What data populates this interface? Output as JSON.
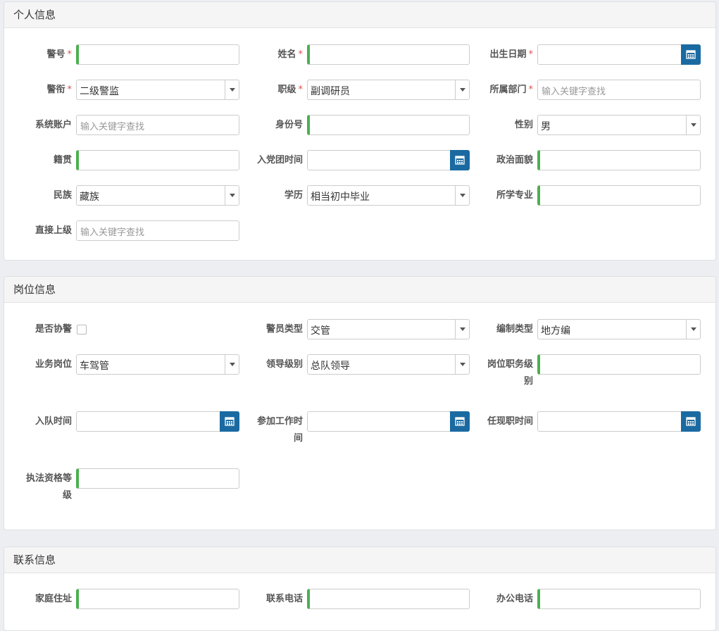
{
  "sections": {
    "personal": {
      "title": "个人信息"
    },
    "position": {
      "title": "岗位信息"
    },
    "contact": {
      "title": "联系信息"
    }
  },
  "personal": {
    "badge_no": {
      "label": "警号",
      "required": "*"
    },
    "name": {
      "label": "姓名",
      "required": "*"
    },
    "birth_date": {
      "label": "出生日期",
      "required": "*"
    },
    "police_rank": {
      "label": "警衔",
      "required": "*",
      "value": "二级警监"
    },
    "job_level": {
      "label": "职级",
      "required": "*",
      "value": "副调研员"
    },
    "department": {
      "label": "所属部门",
      "required": "*",
      "placeholder": "输入关键字查找"
    },
    "system_account": {
      "label": "系统账户",
      "placeholder": "输入关键字查找"
    },
    "id_number": {
      "label": "身份号"
    },
    "gender": {
      "label": "性别",
      "value": "男"
    },
    "native_place": {
      "label": "籍贯"
    },
    "party_join_date": {
      "label": "入党团时间"
    },
    "political_status": {
      "label": "政治面貌"
    },
    "ethnicity": {
      "label": "民族",
      "value": "藏族"
    },
    "education": {
      "label": "学历",
      "value": "相当初中毕业"
    },
    "major": {
      "label": "所学专业"
    },
    "direct_superior": {
      "label": "直接上级",
      "placeholder": "输入关键字查找"
    }
  },
  "position": {
    "is_auxiliary": {
      "label": "是否协警"
    },
    "police_type": {
      "label": "警员类型",
      "value": "交管"
    },
    "staffing_type": {
      "label": "编制类型",
      "value": "地方编"
    },
    "business_post": {
      "label": "业务岗位",
      "value": "车驾管"
    },
    "leader_level": {
      "label": "领导级别",
      "value": "总队领导"
    },
    "post_level_a": "岗位职务级",
    "post_level_b": "别",
    "join_team_date": {
      "label": "入队时间"
    },
    "work_start_a": "参加工作时",
    "work_start_b": "间",
    "current_post_date": {
      "label": "任现职时间"
    },
    "law_qual_a": "执法资格等",
    "law_qual_b": "级"
  },
  "contact": {
    "home_address": {
      "label": "家庭住址"
    },
    "contact_phone": {
      "label": "联系电话"
    },
    "office_phone": {
      "label": "办公电话"
    }
  },
  "icons": {
    "calendar": "calendar-icon",
    "dropdown": "chevron-down-icon"
  },
  "colors": {
    "required": "#d9534f",
    "accent": "#1a6aa1",
    "field_marker": "#4caf50"
  }
}
